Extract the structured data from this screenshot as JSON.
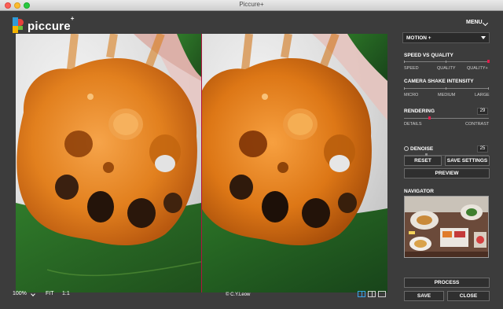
{
  "window": {
    "title": "Piccure+"
  },
  "app": {
    "logo_text": "piccure",
    "logo_super": "+",
    "menu_label": "MENU"
  },
  "mode_dropdown": {
    "selected": "MOTION +"
  },
  "speed_quality": {
    "label": "SPEED VS QUALITY",
    "left": "SPEED",
    "mid": "QUALITY",
    "right": "QUALITY+",
    "level": 1.0
  },
  "camera_shake": {
    "label": "CAMERA SHAKE INTENSITY",
    "left": "MICRO",
    "mid": "MEDIUM",
    "right": "LARGE"
  },
  "rendering": {
    "label": "RENDERING",
    "value": "29",
    "left": "DETAILS",
    "right": "CONTRAST",
    "level": 0.29
  },
  "denoise": {
    "label": "DENOISE",
    "value": "25",
    "level": 0.25
  },
  "buttons": {
    "reset": "RESET",
    "save_settings": "SAVE SETTINGS",
    "preview": "PREVIEW",
    "process": "PROCESS",
    "save": "SAVE",
    "close": "CLOSE"
  },
  "navigator": {
    "label": "NAVIGATOR"
  },
  "bottom": {
    "zoom": "100%",
    "fit": "FIT",
    "one_to_one": "1:1",
    "credit": "© C.Y.Leow"
  },
  "colors": {
    "accent": "#e01c4a",
    "divider": "#b01540",
    "active_view": "#3aa3e8"
  },
  "icons": {
    "view_split": "split-view-icon",
    "view_side": "side-by-side-icon",
    "view_single": "single-view-icon"
  }
}
